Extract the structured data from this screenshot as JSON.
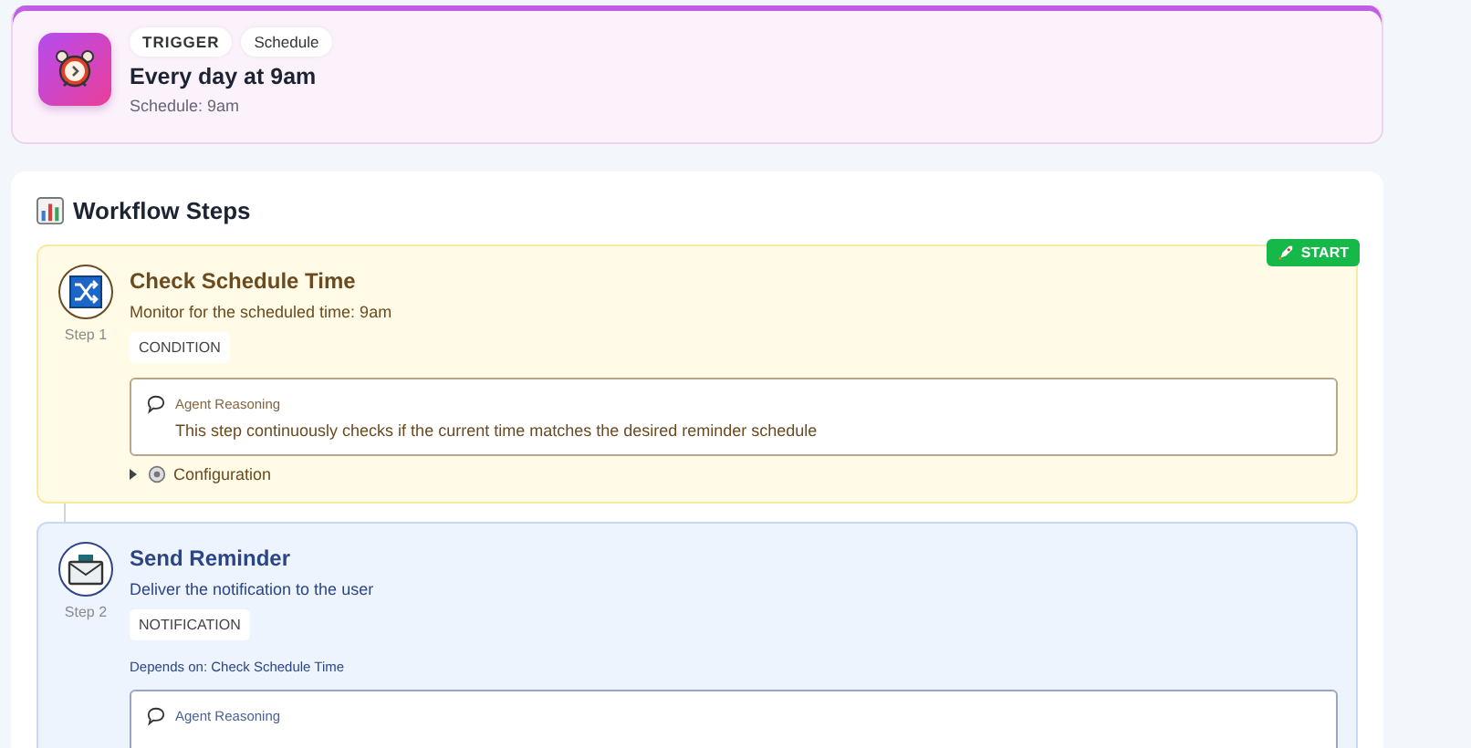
{
  "trigger": {
    "badge": "TRIGGER",
    "type_tag": "Schedule",
    "title": "Every day at 9am",
    "subtitle": "Schedule: 9am"
  },
  "workflow": {
    "heading": "Workflow Steps",
    "steps": [
      {
        "kind": "condition",
        "title": "Check Schedule Time",
        "description": "Monitor for the scheduled time: 9am",
        "step_label": "Step 1",
        "type_tag": "CONDITION",
        "start_badge": "START",
        "reasoning": {
          "label": "Agent Reasoning",
          "text": "This step continuously checks if the current time matches the desired reminder schedule"
        },
        "configuration": {
          "label": "Configuration",
          "expanded": false
        }
      },
      {
        "kind": "notification",
        "title": "Send Reminder",
        "description": "Deliver the notification to the user",
        "step_label": "Step 2",
        "type_tag": "NOTIFICATION",
        "depends_on": "Depends on: Check Schedule Time",
        "reasoning": {
          "label": "Agent Reasoning"
        }
      }
    ]
  }
}
